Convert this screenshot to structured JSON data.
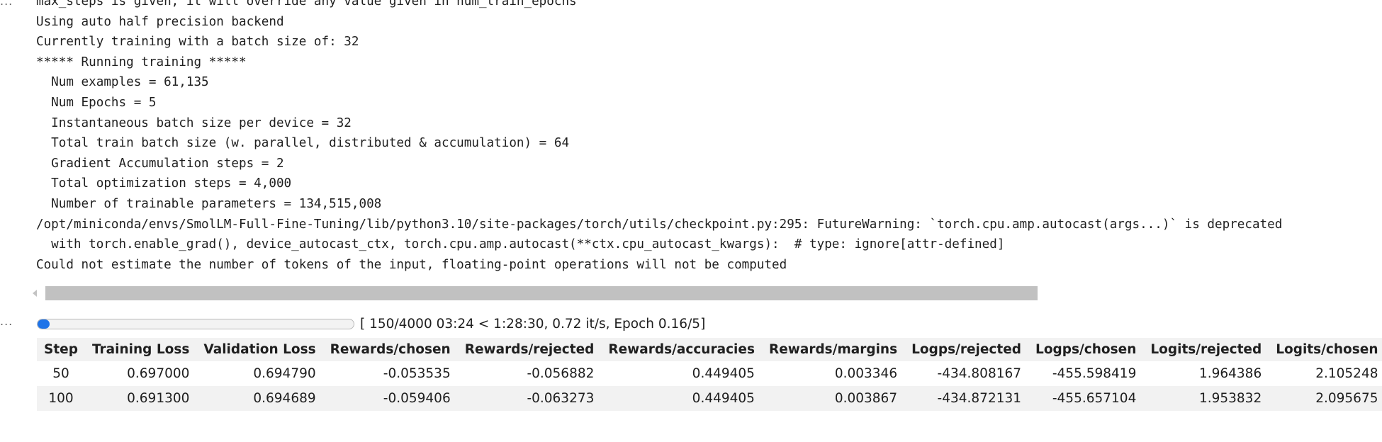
{
  "cell_markers": [
    "...",
    "..."
  ],
  "log_lines": [
    "max_steps is given, it will override any value given in num_train_epochs",
    "Using auto half precision backend",
    "Currently training with a batch size of: 32",
    "***** Running training *****",
    "  Num examples = 61,135",
    "  Num Epochs = 5",
    "  Instantaneous batch size per device = 32",
    "  Total train batch size (w. parallel, distributed & accumulation) = 64",
    "  Gradient Accumulation steps = 2",
    "  Total optimization steps = 4,000",
    "  Number of trainable parameters = 134,515,008",
    "/opt/miniconda/envs/SmolLM-Full-Fine-Tuning/lib/python3.10/site-packages/torch/utils/checkpoint.py:295: FutureWarning: `torch.cpu.amp.autocast(args...)` is deprecated",
    "  with torch.enable_grad(), device_autocast_ctx, torch.cpu.amp.autocast(**ctx.cpu_autocast_kwargs):  # type: ignore[attr-defined]",
    "Could not estimate the number of tokens of the input, floating-point operations will not be computed"
  ],
  "progress": {
    "current": 150,
    "total": 4000,
    "fraction": 0.0375,
    "text": "[ 150/4000 03:24 < 1:28:30, 0.72 it/s, Epoch 0.16/5]",
    "fill_color": "#1e73e8"
  },
  "table": {
    "columns": [
      "Step",
      "Training Loss",
      "Validation Loss",
      "Rewards/chosen",
      "Rewards/rejected",
      "Rewards/accuracies",
      "Rewards/margins",
      "Logps/rejected",
      "Logps/chosen",
      "Logits/rejected",
      "Logits/chosen"
    ],
    "rows": [
      [
        "50",
        "0.697000",
        "0.694790",
        "-0.053535",
        "-0.056882",
        "0.449405",
        "0.003346",
        "-434.808167",
        "-455.598419",
        "1.964386",
        "2.105248"
      ],
      [
        "100",
        "0.691300",
        "0.694689",
        "-0.059406",
        "-0.063273",
        "0.449405",
        "0.003867",
        "-434.872131",
        "-455.657104",
        "1.953832",
        "2.095675"
      ]
    ]
  }
}
